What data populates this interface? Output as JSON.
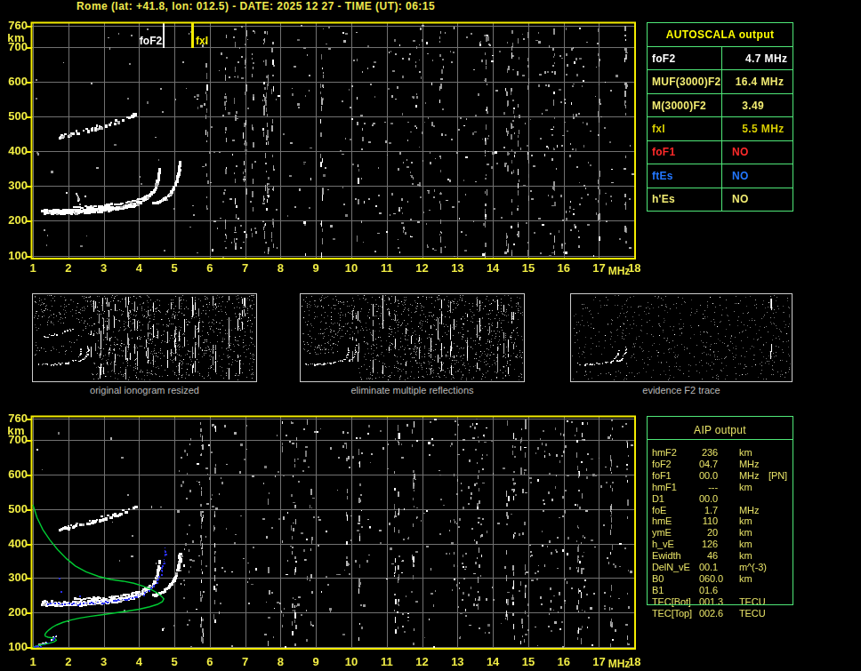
{
  "header": {
    "title": "Rome (lat: +41.8, lon: 012.5) - DATE: 2025 12 27 - TIME (UT): 06:15"
  },
  "colors": {
    "background": "#000000",
    "axis_border_yellow": "#f4ec00",
    "axis_text_yellow": "#f0ec44",
    "grid_gray": "#717171",
    "table_border_green": "#4fe878",
    "trace_white": "#ffffff",
    "noise_gray": "#9a9a9a",
    "profile_green": "#00cc33",
    "autoscaled_blue": "#2a31f0",
    "caption_gray": "#b9b9b9",
    "aip_text_yellow": "#e9e468",
    "thumb_border_gray": "#cccccc"
  },
  "autoscala_table": {
    "title": "AUTOSCALA output",
    "rows": [
      {
        "label": "foF2",
        "value": "    4.7 MHz",
        "color": "#ffffff"
      },
      {
        "label": "MUF(3000)F2",
        "value": " 16.4 MHz",
        "color": "#f2ec72"
      },
      {
        "label": "M(3000)F2",
        "value": "   3.49",
        "color": "#f2ec72"
      },
      {
        "label": "fxI",
        "value": "   5.5 MHz",
        "color": "#d8ce00"
      },
      {
        "label": "foF1",
        "value": "NO",
        "color": "#ff2a2a"
      },
      {
        "label": "ftEs",
        "value": "NO",
        "color": "#2377ff"
      },
      {
        "label": "h'Es",
        "value": "NO",
        "color": "#f2ec72"
      }
    ]
  },
  "aip_table": {
    "title": "AIP output",
    "rows": [
      {
        "name": "hmF2",
        "value": "236",
        "unit": "km",
        "pn": ""
      },
      {
        "name": "foF2",
        "value": "04.7",
        "unit": "MHz",
        "pn": ""
      },
      {
        "name": "foF1",
        "value": "00.0",
        "unit": "MHz",
        "pn": "[PN]"
      },
      {
        "name": "hmF1",
        "value": "---",
        "unit": "km",
        "pn": ""
      },
      {
        "name": "D1",
        "value": "00.0",
        "unit": "",
        "pn": ""
      },
      {
        "name": "foE",
        "value": "1.7",
        "unit": "MHz",
        "pn": ""
      },
      {
        "name": "hmE",
        "value": "110",
        "unit": "km",
        "pn": ""
      },
      {
        "name": "ymE",
        "value": "20",
        "unit": "km",
        "pn": ""
      },
      {
        "name": "h_vE",
        "value": "126",
        "unit": "km",
        "pn": ""
      },
      {
        "name": "Ewidth",
        "value": "46",
        "unit": "km",
        "pn": ""
      },
      {
        "name": "DelN_vE",
        "value": "00.1",
        "unit": "m^(-3)",
        "pn": ""
      },
      {
        "name": "B0",
        "value": "060.0",
        "unit": "km",
        "pn": ""
      },
      {
        "name": "B1",
        "value": "01.6",
        "unit": "",
        "pn": ""
      },
      {
        "name": "TEC[Bot]",
        "value": "001.3",
        "unit": "TECU",
        "pn": ""
      },
      {
        "name": "TEC[Top]",
        "value": "002.6",
        "unit": "TECU",
        "pn": ""
      }
    ]
  },
  "thumbnails": [
    {
      "caption": "original ionogram resized",
      "shows_traces": [
        "second_hop",
        "f2_o",
        "f2_x"
      ],
      "noise_level": "high",
      "streaks": 44
    },
    {
      "caption": "eliminate multiple reflections",
      "shows_traces": [
        "f2_o",
        "f2_x"
      ],
      "noise_level": "high",
      "streaks": 32
    },
    {
      "caption": "evidence F2 trace",
      "shows_traces": [
        "f2_o",
        "f2_x"
      ],
      "noise_level": "sparse",
      "streaks": 2
    }
  ],
  "chart_data": [
    {
      "id": "main_ionogram",
      "type": "scatter",
      "title": "Rome (lat: +41.8, lon: 012.5) - DATE: 2025 12 27 - TIME (UT): 06:15",
      "xlabel": "MHz",
      "ylabel": "km",
      "xlim": [
        0.95,
        18.02
      ],
      "ylim": [
        91,
        769
      ],
      "x_ticks": [
        1,
        2,
        3,
        4,
        5,
        6,
        7,
        8,
        9,
        10,
        11,
        12,
        13,
        14,
        15,
        16,
        17,
        18
      ],
      "y_ticks": [
        760,
        700,
        600,
        500,
        400,
        300,
        200,
        100
      ],
      "grid": true,
      "markers": [
        {
          "label": "foF2",
          "freq_mhz": 4.7,
          "color": "#ffffff"
        },
        {
          "label": "fxI",
          "freq_mhz": 5.5,
          "color": "#f4ec00"
        }
      ],
      "traces": {
        "f2_o": [
          [
            1.28,
            227
          ],
          [
            1.7,
            225
          ],
          [
            2.1,
            226
          ],
          [
            2.5,
            228
          ],
          [
            2.9,
            231
          ],
          [
            3.3,
            236
          ],
          [
            3.6,
            241
          ],
          [
            3.85,
            247
          ],
          [
            4.05,
            254
          ],
          [
            4.22,
            263
          ],
          [
            4.35,
            275
          ],
          [
            4.45,
            290
          ],
          [
            4.52,
            308
          ],
          [
            4.56,
            328
          ],
          [
            4.58,
            348
          ]
        ],
        "f2_x": [
          [
            4.42,
            250
          ],
          [
            4.58,
            254
          ],
          [
            4.72,
            262
          ],
          [
            4.86,
            275
          ],
          [
            4.98,
            292
          ],
          [
            5.07,
            312
          ],
          [
            5.12,
            332
          ],
          [
            5.15,
            350
          ],
          [
            5.16,
            368
          ]
        ],
        "x_flat": [
          [
            2.2,
            239
          ],
          [
            2.6,
            240
          ],
          [
            3.0,
            243
          ],
          [
            3.4,
            248
          ],
          [
            3.7,
            253
          ],
          [
            3.95,
            259
          ],
          [
            4.15,
            266
          ],
          [
            4.3,
            275
          ]
        ],
        "second_hop": [
          [
            1.75,
            438
          ],
          [
            2.0,
            444
          ],
          [
            2.3,
            451
          ],
          [
            2.6,
            458
          ],
          [
            2.9,
            466
          ],
          [
            3.2,
            475
          ],
          [
            3.5,
            485
          ],
          [
            3.75,
            495
          ],
          [
            3.92,
            504
          ]
        ],
        "e_cusp": [
          [
            2.25,
            278
          ],
          [
            2.27,
            266
          ],
          [
            2.3,
            255
          ],
          [
            2.34,
            247
          ]
        ]
      }
    },
    {
      "id": "restored_ionogram",
      "type": "scatter",
      "xlabel": "MHz",
      "ylabel": "km",
      "xlim": [
        0.95,
        18.02
      ],
      "ylim": [
        91,
        769
      ],
      "x_ticks": [
        1,
        2,
        3,
        4,
        5,
        6,
        7,
        8,
        9,
        10,
        11,
        12,
        13,
        14,
        15,
        16,
        17,
        18
      ],
      "y_ticks": [
        760,
        700,
        600,
        500,
        400,
        300,
        200,
        100
      ],
      "grid": true,
      "traces": {
        "f2_o": [
          [
            1.28,
            227
          ],
          [
            1.7,
            225
          ],
          [
            2.1,
            226
          ],
          [
            2.5,
            228
          ],
          [
            2.9,
            231
          ],
          [
            3.3,
            236
          ],
          [
            3.6,
            241
          ],
          [
            3.85,
            247
          ],
          [
            4.05,
            254
          ],
          [
            4.22,
            263
          ],
          [
            4.35,
            275
          ],
          [
            4.45,
            290
          ],
          [
            4.52,
            308
          ],
          [
            4.56,
            328
          ],
          [
            4.58,
            348
          ]
        ],
        "f2_x": [
          [
            4.42,
            250
          ],
          [
            4.58,
            254
          ],
          [
            4.72,
            262
          ],
          [
            4.86,
            275
          ],
          [
            4.98,
            292
          ],
          [
            5.07,
            312
          ],
          [
            5.12,
            332
          ],
          [
            5.15,
            350
          ],
          [
            5.16,
            368
          ]
        ],
        "x_flat": [
          [
            2.2,
            239
          ],
          [
            2.6,
            240
          ],
          [
            3.0,
            243
          ],
          [
            3.4,
            248
          ],
          [
            3.7,
            253
          ],
          [
            3.95,
            259
          ],
          [
            4.15,
            266
          ],
          [
            4.3,
            275
          ]
        ],
        "second_hop": [
          [
            1.75,
            438
          ],
          [
            2.0,
            444
          ],
          [
            2.3,
            451
          ],
          [
            2.6,
            458
          ],
          [
            2.9,
            466
          ],
          [
            3.2,
            475
          ],
          [
            3.5,
            485
          ],
          [
            3.75,
            495
          ],
          [
            3.92,
            504
          ]
        ],
        "e_trace": [
          [
            1.02,
            101
          ],
          [
            1.12,
            104
          ],
          [
            1.25,
            108
          ],
          [
            1.38,
            113
          ],
          [
            1.5,
            120
          ],
          [
            1.58,
            127
          ],
          [
            1.63,
            133
          ]
        ]
      },
      "profile_green": [
        [
          1.0,
          512
        ],
        [
          1.12,
          474
        ],
        [
          1.28,
          440
        ],
        [
          1.48,
          410
        ],
        [
          1.7,
          382
        ],
        [
          1.95,
          356
        ],
        [
          2.2,
          335
        ],
        [
          2.5,
          318
        ],
        [
          2.85,
          305
        ],
        [
          3.2,
          296
        ],
        [
          3.55,
          291
        ],
        [
          3.85,
          285
        ],
        [
          4.1,
          277
        ],
        [
          4.32,
          268
        ],
        [
          4.5,
          258
        ],
        [
          4.63,
          248
        ],
        [
          4.7,
          240
        ],
        [
          4.66,
          232
        ],
        [
          4.52,
          224
        ],
        [
          4.3,
          217
        ],
        [
          4.0,
          210
        ],
        [
          3.65,
          204
        ],
        [
          3.3,
          199
        ],
        [
          2.95,
          194
        ],
        [
          2.6,
          189
        ],
        [
          2.3,
          184
        ],
        [
          2.05,
          178
        ],
        [
          1.85,
          172
        ],
        [
          1.68,
          165
        ],
        [
          1.55,
          158
        ],
        [
          1.45,
          150
        ],
        [
          1.38,
          143
        ],
        [
          1.34,
          137
        ],
        [
          1.35,
          132
        ],
        [
          1.43,
          129
        ],
        [
          1.55,
          127
        ],
        [
          1.64,
          124
        ],
        [
          1.66,
          120
        ],
        [
          1.6,
          116
        ],
        [
          1.48,
          112
        ],
        [
          1.33,
          109
        ],
        [
          1.18,
          106
        ],
        [
          1.07,
          103
        ],
        [
          1.01,
          99
        ]
      ],
      "autoscaled_points": [
        [
          1.35,
          228
        ],
        [
          1.8,
          226
        ],
        [
          2.3,
          227
        ],
        [
          2.8,
          230
        ],
        [
          3.2,
          234
        ],
        [
          3.55,
          239
        ],
        [
          3.85,
          246
        ],
        [
          4.1,
          255
        ],
        [
          4.28,
          266
        ],
        [
          4.42,
          280
        ],
        [
          4.53,
          298
        ],
        [
          4.62,
          320
        ],
        [
          4.68,
          345
        ],
        [
          4.72,
          368
        ],
        [
          4.74,
          388
        ]
      ],
      "autoscaled_e_points": [
        [
          1.02,
          101
        ],
        [
          1.12,
          104
        ],
        [
          1.25,
          108
        ],
        [
          1.38,
          113
        ],
        [
          1.5,
          120
        ],
        [
          1.58,
          127
        ],
        [
          1.63,
          133
        ]
      ],
      "autoscaled_isolated": [
        [
          1.72,
          302
        ],
        [
          1.78,
          262
        ],
        [
          2.3,
          251
        ]
      ]
    }
  ]
}
